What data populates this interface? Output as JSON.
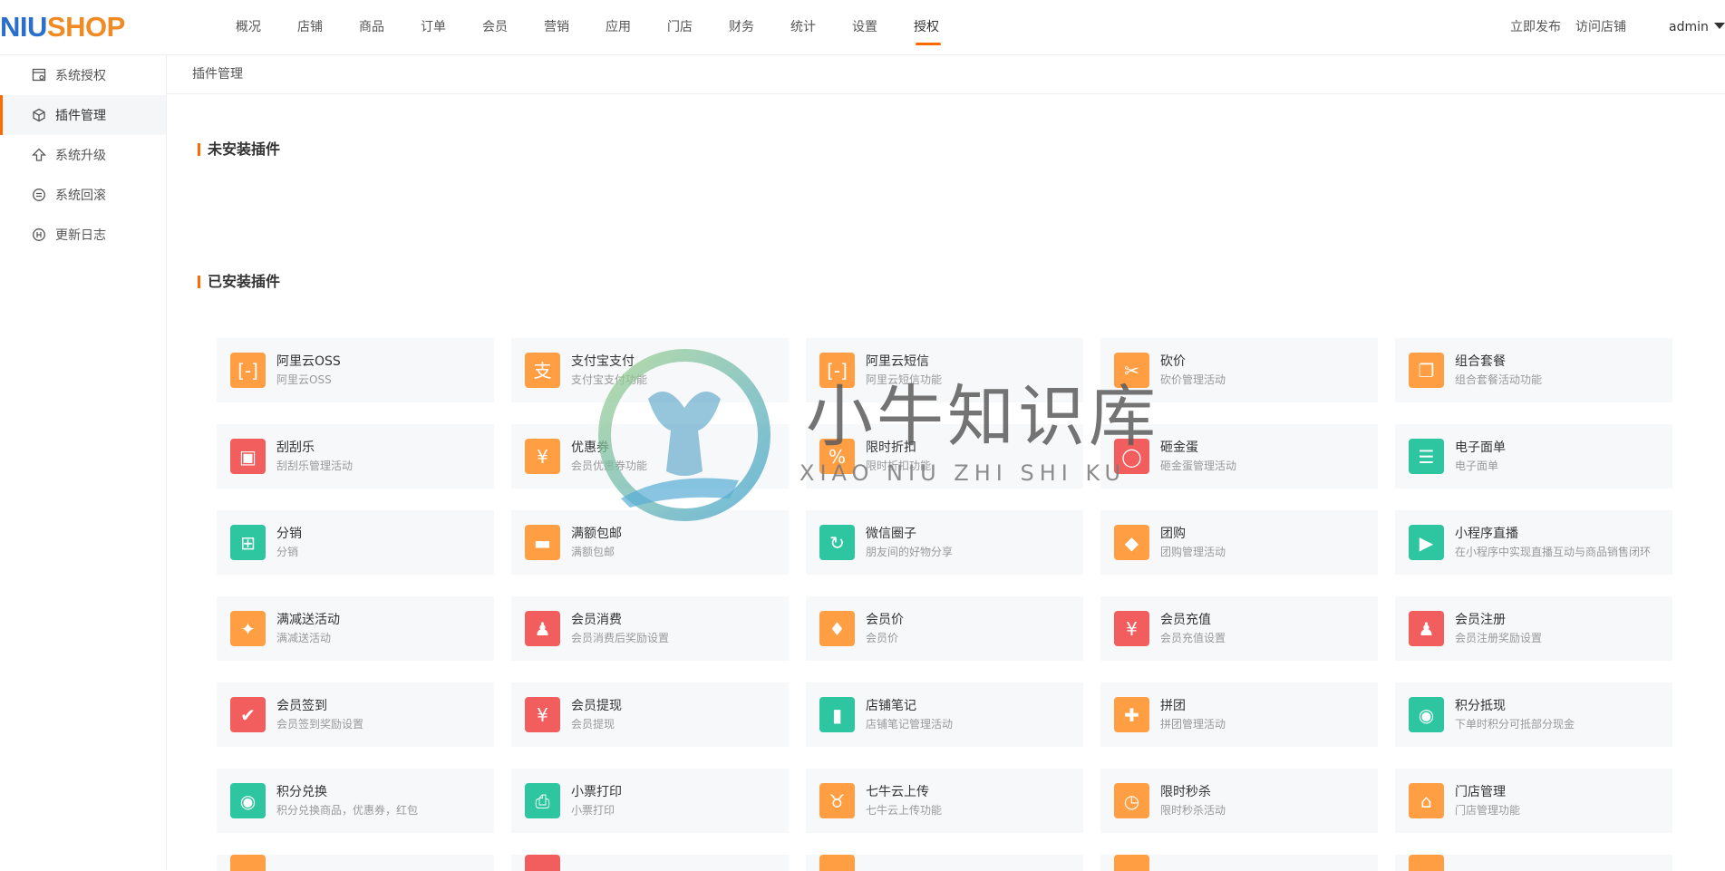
{
  "header": {
    "logo_part1": "NIU",
    "logo_part2": "SHOP",
    "nav": [
      "概况",
      "店铺",
      "商品",
      "订单",
      "会员",
      "营销",
      "应用",
      "门店",
      "财务",
      "统计",
      "设置",
      "授权"
    ],
    "active_nav": "授权",
    "links": [
      "立即发布",
      "访问店铺"
    ],
    "user": "admin"
  },
  "sidebar": {
    "items": [
      {
        "label": "系统授权",
        "icon": "license-icon"
      },
      {
        "label": "插件管理",
        "icon": "cube-icon",
        "active": true
      },
      {
        "label": "系统升级",
        "icon": "upgrade-icon"
      },
      {
        "label": "系统回滚",
        "icon": "rollback-icon"
      },
      {
        "label": "更新日志",
        "icon": "log-icon"
      }
    ]
  },
  "breadcrumb": "插件管理",
  "sections": {
    "uninstalled": "未安装插件",
    "installed": "已安装插件"
  },
  "colors": {
    "accent": "#ff6a00",
    "orange": "#ff9e42",
    "red": "#f25e5e",
    "green": "#2ec6a0"
  },
  "plugins": [
    {
      "name": "阿里云OSS",
      "desc": "阿里云OSS",
      "color": "orange",
      "icon": "oss-icon"
    },
    {
      "name": "支付宝支付",
      "desc": "支付宝支付功能",
      "color": "orange",
      "icon": "alipay-icon"
    },
    {
      "name": "阿里云短信",
      "desc": "阿里云短信功能",
      "color": "orange",
      "icon": "sms-icon"
    },
    {
      "name": "砍价",
      "desc": "砍价管理活动",
      "color": "orange",
      "icon": "bargain-icon"
    },
    {
      "name": "组合套餐",
      "desc": "组合套餐活动功能",
      "color": "orange",
      "icon": "combo-icon"
    },
    {
      "name": "刮刮乐",
      "desc": "刮刮乐管理活动",
      "color": "red",
      "icon": "scratch-card-icon"
    },
    {
      "name": "优惠券",
      "desc": "会员优惠券功能",
      "color": "orange",
      "icon": "coupon-icon"
    },
    {
      "name": "限时折扣",
      "desc": "限时折扣功能",
      "color": "orange",
      "icon": "discount-icon"
    },
    {
      "name": "砸金蛋",
      "desc": "砸金蛋管理活动",
      "color": "red",
      "icon": "egg-icon"
    },
    {
      "name": "电子面单",
      "desc": "电子面单",
      "color": "green",
      "icon": "waybill-icon"
    },
    {
      "name": "分销",
      "desc": "分销",
      "color": "green",
      "icon": "distribution-icon"
    },
    {
      "name": "满额包邮",
      "desc": "满额包邮",
      "color": "orange",
      "icon": "truck-icon"
    },
    {
      "name": "微信圈子",
      "desc": "朋友间的好物分享",
      "color": "green",
      "icon": "circle-icon"
    },
    {
      "name": "团购",
      "desc": "团购管理活动",
      "color": "orange",
      "icon": "tag-icon"
    },
    {
      "name": "小程序直播",
      "desc": "在小程序中实现直播互动与商品销售闭环",
      "color": "green",
      "icon": "live-icon"
    },
    {
      "name": "满减送活动",
      "desc": "满减送活动",
      "color": "orange",
      "icon": "gift-icon"
    },
    {
      "name": "会员消费",
      "desc": "会员消费后奖励设置",
      "color": "red",
      "icon": "member-consume-icon"
    },
    {
      "name": "会员价",
      "desc": "会员价",
      "color": "orange",
      "icon": "member-price-icon"
    },
    {
      "name": "会员充值",
      "desc": "会员充值设置",
      "color": "red",
      "icon": "recharge-icon"
    },
    {
      "name": "会员注册",
      "desc": "会员注册奖励设置",
      "color": "red",
      "icon": "register-icon"
    },
    {
      "name": "会员签到",
      "desc": "会员签到奖励设置",
      "color": "red",
      "icon": "calendar-icon"
    },
    {
      "name": "会员提现",
      "desc": "会员提现",
      "color": "red",
      "icon": "withdraw-icon"
    },
    {
      "name": "店铺笔记",
      "desc": "店铺笔记管理活动",
      "color": "green",
      "icon": "notebook-icon"
    },
    {
      "name": "拼团",
      "desc": "拼团管理活动",
      "color": "orange",
      "icon": "puzzle-icon"
    },
    {
      "name": "积分抵现",
      "desc": "下单时积分可抵部分现金",
      "color": "green",
      "icon": "coins-icon"
    },
    {
      "name": "积分兑换",
      "desc": "积分兑换商品，优惠券，红包",
      "color": "green",
      "icon": "exchange-icon"
    },
    {
      "name": "小票打印",
      "desc": "小票打印",
      "color": "green",
      "icon": "printer-icon"
    },
    {
      "name": "七牛云上传",
      "desc": "七牛云上传功能",
      "color": "orange",
      "icon": "qiniu-icon"
    },
    {
      "name": "限时秒杀",
      "desc": "限时秒杀活动",
      "color": "orange",
      "icon": "alarm-icon"
    },
    {
      "name": "门店管理",
      "desc": "门店管理功能",
      "color": "orange",
      "icon": "store-icon"
    }
  ],
  "partial_row_colors": [
    "orange",
    "red",
    "orange",
    "orange",
    "orange"
  ],
  "watermark": {
    "title": "小牛知识库",
    "subtitle": "XIAO NIU ZHI SHI KU"
  }
}
